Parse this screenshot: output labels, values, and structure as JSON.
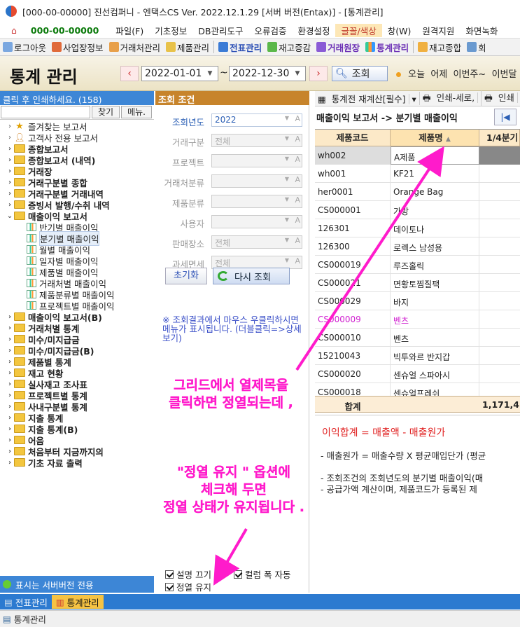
{
  "titlebar": {
    "title": "[000-00-00000] 진선컴퍼니 - 엔택스CS Ver. 2022.12.1.29 [서버 버전(Entax)] - [통계관리]"
  },
  "menubar": {
    "company_code": "000-00-00000",
    "items": [
      "파일(F)",
      "기초정보",
      "DB관리도구",
      "오류검증",
      "환경설정",
      "글꼴/색상",
      "창(W)",
      "원격지원",
      "화면녹화"
    ]
  },
  "toolbar": {
    "items": [
      "로그아웃",
      "사업장정보",
      "거래처관리",
      "제품관리",
      "전표관리",
      "재고증감",
      "거래원장",
      "통계관리",
      "재고종합",
      "회"
    ]
  },
  "header": {
    "title": "통계 관리",
    "date_from": "2022-01-01",
    "date_sep": "~",
    "date_to": "2022-12-30",
    "query_label": "조회",
    "quick": [
      "오늘",
      "어제",
      "이번주~",
      "이번달"
    ]
  },
  "left_panel": {
    "header": "클릭 후 인쇄하세요. (158)",
    "find_label": "찾기",
    "menu_label": "메뉴.",
    "tree": [
      {
        "label": "즐겨찾는 보고서",
        "kind": "star",
        "bold": false
      },
      {
        "label": "고객사 전용 보고서",
        "kind": "user",
        "bold": false
      },
      {
        "label": "종합보고서",
        "kind": "folder",
        "bold": true
      },
      {
        "label": "종합보고서 (내역)",
        "kind": "folder",
        "bold": true
      },
      {
        "label": "거래장",
        "kind": "folder",
        "bold": true
      },
      {
        "label": "거래구분별 종합",
        "kind": "folder",
        "bold": true
      },
      {
        "label": "거래구분별 거래내역",
        "kind": "folder",
        "bold": true
      },
      {
        "label": "증빙서 발행/수취 내역",
        "kind": "folder",
        "bold": true
      },
      {
        "label": "매출이익 보고서",
        "kind": "folder",
        "bold": true,
        "expanded": true
      },
      {
        "label": "반기별 매출이익",
        "kind": "chart",
        "bold": false,
        "child": true
      },
      {
        "label": "분기별 매출이익",
        "kind": "chart",
        "bold": false,
        "child": true,
        "selected": true
      },
      {
        "label": "월별 매출이익",
        "kind": "chart",
        "bold": false,
        "child": true
      },
      {
        "label": "일자별 매출이익",
        "kind": "chart",
        "bold": false,
        "child": true
      },
      {
        "label": "제품별 매출이익",
        "kind": "chart",
        "bold": false,
        "child": true
      },
      {
        "label": "거래처별 매출이익",
        "kind": "chart",
        "bold": false,
        "child": true
      },
      {
        "label": "제품분류별 매출이익",
        "kind": "chart",
        "bold": false,
        "child": true
      },
      {
        "label": "프로젝트별 매출이익",
        "kind": "chart",
        "bold": false,
        "child": true
      },
      {
        "label": "매출이익 보고서(B)",
        "kind": "folder",
        "bold": true
      },
      {
        "label": "거래처별 통계",
        "kind": "folder",
        "bold": true
      },
      {
        "label": "미수/미지급금",
        "kind": "folder",
        "bold": true
      },
      {
        "label": "미수/미지급금(B)",
        "kind": "folder",
        "bold": true
      },
      {
        "label": "제품별 통계",
        "kind": "folder",
        "bold": true
      },
      {
        "label": "재고 현황",
        "kind": "folder",
        "bold": true
      },
      {
        "label": "실사재고 조사표",
        "kind": "folder",
        "bold": true
      },
      {
        "label": "프로젝트별 통계",
        "kind": "folder",
        "bold": true
      },
      {
        "label": "사내구분별 통계",
        "kind": "folder",
        "bold": true
      },
      {
        "label": "지출 통계",
        "kind": "folder",
        "bold": true
      },
      {
        "label": "지출 통계(B)",
        "kind": "folder",
        "bold": true
      },
      {
        "label": "어음",
        "kind": "folder",
        "bold": true
      },
      {
        "label": "처음부터 지금까지의",
        "kind": "folder",
        "bold": true
      },
      {
        "label": "기초 자료 출력",
        "kind": "folder",
        "bold": true
      }
    ],
    "footer": "표시는 서버버전 전용"
  },
  "condition_panel": {
    "header": "조회 조건",
    "fields": [
      {
        "label": "조회년도",
        "value": "2022",
        "enabled": true
      },
      {
        "label": "거래구분",
        "value": "전체",
        "enabled": false
      },
      {
        "label": "프로젝트",
        "value": "",
        "enabled": false
      },
      {
        "label": "거래처분류",
        "value": "",
        "enabled": false
      },
      {
        "label": "제품분류",
        "value": "",
        "enabled": false
      },
      {
        "label": "사용자",
        "value": "",
        "enabled": false
      },
      {
        "label": "판매장소",
        "value": "전체",
        "enabled": false
      },
      {
        "label": "과세면세",
        "value": "전체",
        "enabled": false
      }
    ],
    "reset_label": "초기화",
    "requery_label": "다시 조회",
    "hint": "※ 조회결과에서 마우스 우클릭하시면 메뉴가 표시됩니다. (더블클릭=>상세보기)",
    "checkboxes": {
      "hide_desc": "설명 끄기",
      "auto_width": "컬럼 폭 자동",
      "keep_sort": "정열 유지"
    }
  },
  "grid_panel": {
    "tools": [
      "통계전 재계산[필수]",
      "인쇄-세로,",
      "인쇄"
    ],
    "title": "매출이익 보고서 -> 분기별 매출이익",
    "columns": [
      "제품코드",
      "제품명",
      "1/4분기"
    ],
    "rows": [
      {
        "code": "wh002",
        "name": "A제품",
        "selected": true
      },
      {
        "code": "wh001",
        "name": "KF21"
      },
      {
        "code": "her0001",
        "name": "Orange Bag"
      },
      {
        "code": "CS000001",
        "name": "가방"
      },
      {
        "code": "126301",
        "name": "데이토나"
      },
      {
        "code": "126300",
        "name": "로렉스 남성용"
      },
      {
        "code": "CS000019",
        "name": "루즈홀릭"
      },
      {
        "code": "CS000021",
        "name": "면황토찜질팩"
      },
      {
        "code": "CS000029",
        "name": "바지"
      },
      {
        "code": "CS000009",
        "name": "벤츠",
        "pink": true
      },
      {
        "code": "CS000010",
        "name": "벤츠"
      },
      {
        "code": "15210043",
        "name": "빅투와르 반지갑"
      },
      {
        "code": "CS000020",
        "name": "센슈얼 스파아시"
      },
      {
        "code": "CS000018",
        "name": "센슈얼프레쉬"
      }
    ],
    "sum_label": "합계",
    "sum_value": "1,171,4",
    "info": {
      "formula": "이익합계 = 매출액 - 매출원가",
      "line1": "- 매출원가 = 매출수량 X 평균매입단가 (평균",
      "line2": "- 조회조건의 조회년도의 분기별 매출이익(매",
      "line3": "- 공급가액 계산이며, 제품코드가 등록된 제"
    }
  },
  "annotations": {
    "a1_line1": "그리드에서 열제목을",
    "a1_line2": "클릭하면 정열되는데 ,",
    "a2_line1": "\"정열 유지 \" 옵션에",
    "a2_line2": "체크해 두면",
    "a2_line3": "정열 상태가 유지됩니다 ."
  },
  "bottom_tabs": [
    "전표관리",
    "통계관리"
  ],
  "statusbar": {
    "text": "통계관리"
  },
  "colors": {
    "accent_blue": "#3d86d6",
    "condition_header": "#c7842b",
    "annotation": "#ff1bcb",
    "grid_header": "#fce9c8"
  }
}
